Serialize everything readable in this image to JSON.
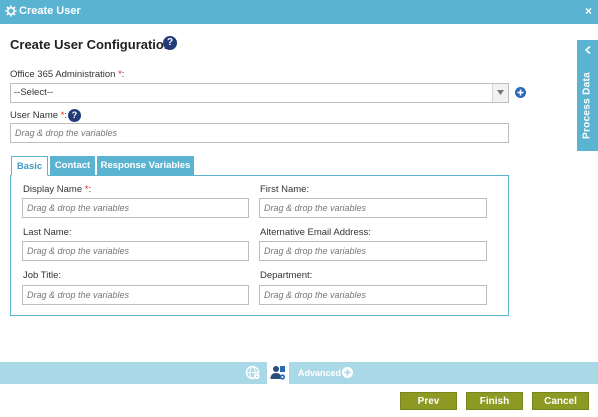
{
  "window": {
    "title": "Create User",
    "close_symbol": "×"
  },
  "page": {
    "heading": "Create User Configuration",
    "help_symbol": "?"
  },
  "form": {
    "office365": {
      "label": "Office 365 Administration",
      "required_mark": "*",
      "colon": ":",
      "selected": "--Select--"
    },
    "user_name": {
      "label": "User Name",
      "required_mark": "*",
      "colon": ":",
      "placeholder": "Drag & drop the variables"
    }
  },
  "tabs": [
    {
      "label": "Basic",
      "active": true
    },
    {
      "label": "Contact",
      "active": false
    },
    {
      "label": "Response Variables",
      "active": false
    }
  ],
  "basic": {
    "display_name": {
      "label": "Display Name",
      "required_mark": "*",
      "colon": ":",
      "placeholder": "Drag & drop the variables"
    },
    "first_name": {
      "label": "First Name:",
      "placeholder": "Drag & drop the variables"
    },
    "last_name": {
      "label": "Last Name:",
      "placeholder": "Drag & drop the variables"
    },
    "alt_email": {
      "label": "Alternative Email Address:",
      "placeholder": "Drag & drop the variables"
    },
    "job_title": {
      "label": "Job Title:",
      "placeholder": "Drag & drop the variables"
    },
    "department": {
      "label": "Department:",
      "placeholder": "Drag & drop the variables"
    }
  },
  "side_panel": {
    "label": "Process Data"
  },
  "toolbar": {
    "advanced_label": "Advanced"
  },
  "buttons": {
    "prev": "Prev",
    "finish": "Finish",
    "cancel": "Cancel"
  },
  "icons": {
    "window": "gear-icon",
    "help": "help-icon",
    "dropdown": "chevron-down-icon",
    "add": "plus-circle-icon",
    "side": "chevron-left-icon",
    "globe": "globe-icon",
    "user": "user-settings-icon"
  },
  "colors": {
    "accent": "#5ab4d1",
    "toolbar": "#a9d8e7",
    "button": "#8c9a24",
    "required": "#e2231a",
    "help": "#243b7a",
    "add": "#2a6ab8"
  }
}
